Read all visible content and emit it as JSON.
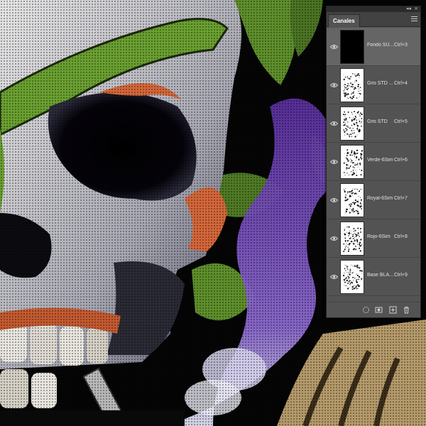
{
  "panel": {
    "tab_label": "Canales",
    "collapse_glyph": "◂◂",
    "close_glyph": "×"
  },
  "channels": [
    {
      "name": "Fondo SU...",
      "shortcut": "Ctrl+3",
      "thumb": "black",
      "selected": true
    },
    {
      "name": "Gris STD ...",
      "shortcut": "Ctrl+4",
      "thumb": "speckle-a",
      "selected": false
    },
    {
      "name": "Gris STD",
      "shortcut": "Ctrl+5",
      "thumb": "speckle-b",
      "selected": false
    },
    {
      "name": "Verde-6Sim",
      "shortcut": "Ctrl+6",
      "thumb": "speckle-c",
      "selected": false
    },
    {
      "name": "Royal-6Sim",
      "shortcut": "Ctrl+7",
      "thumb": "speckle-d",
      "selected": false
    },
    {
      "name": "Rojo-6Sim",
      "shortcut": "Ctrl+8",
      "thumb": "speckle-e",
      "selected": false
    },
    {
      "name": "Base BLA...",
      "shortcut": "Ctrl+9",
      "thumb": "speckle-f",
      "selected": false
    }
  ],
  "footer_icons": [
    "load-selection-icon",
    "save-selection-icon",
    "new-channel-icon",
    "delete-channel-icon"
  ],
  "colors": {
    "panel_bg": "#535353",
    "panel_header": "#424242",
    "selected_row": "#656565",
    "skull_bone": "#c9c9c9",
    "helmet_green": "#5e8f2b",
    "smoke_purple": "#6a3fb0",
    "accent_orange": "#d4673a",
    "bark_tan": "#b59a6a"
  }
}
